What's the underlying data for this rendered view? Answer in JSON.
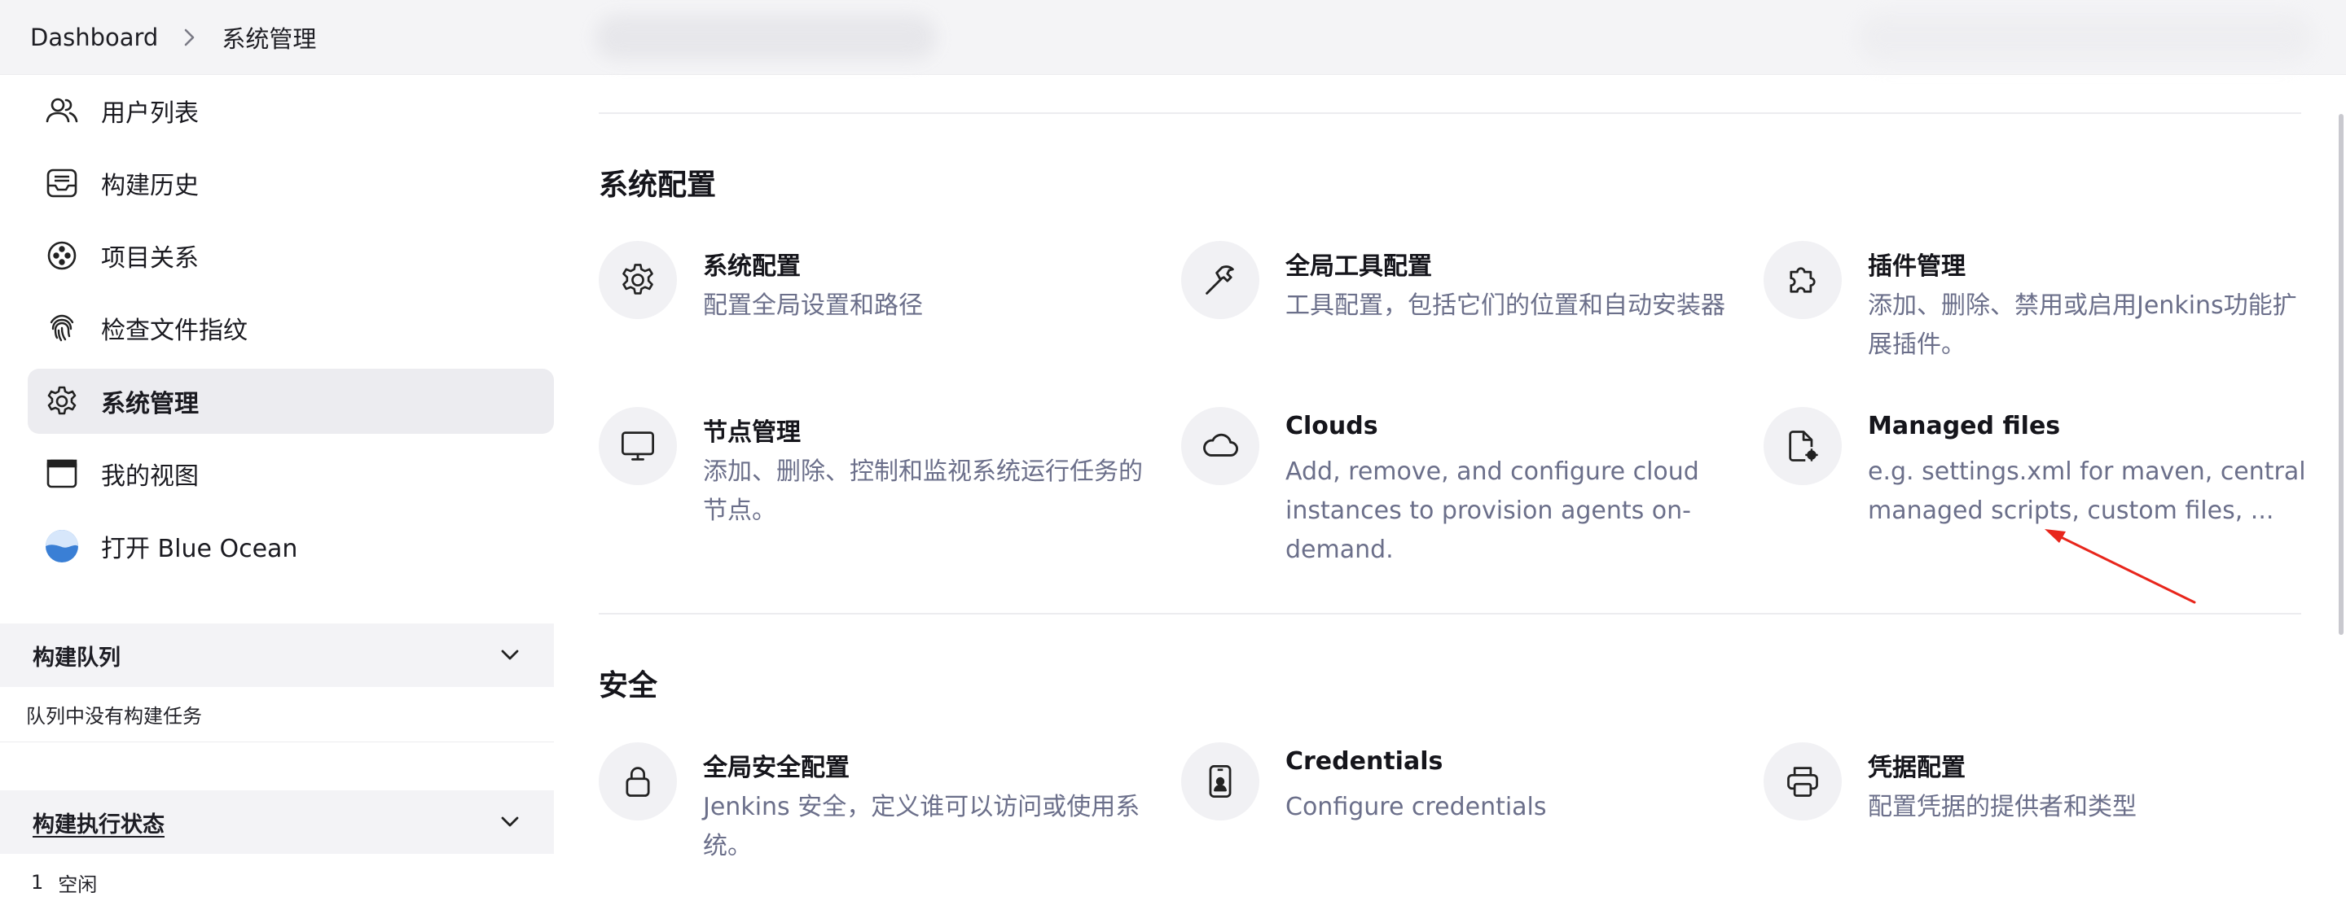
{
  "breadcrumb": {
    "home": "Dashboard",
    "current": "系统管理"
  },
  "sidebar": {
    "items": [
      {
        "label": "用户列表",
        "icon": "users-icon"
      },
      {
        "label": "构建历史",
        "icon": "inbox-icon"
      },
      {
        "label": "项目关系",
        "icon": "relationship-icon"
      },
      {
        "label": "检查文件指纹",
        "icon": "fingerprint-icon"
      },
      {
        "label": "系统管理",
        "icon": "gear-icon",
        "active": true
      },
      {
        "label": "我的视图",
        "icon": "window-icon"
      },
      {
        "label": "打开 Blue Ocean",
        "icon": "blue-ocean-icon"
      }
    ]
  },
  "build_queue": {
    "title": "构建队列",
    "empty_text": "队列中没有构建任务"
  },
  "executors": {
    "title": "构建执行状态",
    "row_index": "1",
    "row_status": "空闲"
  },
  "sections": [
    {
      "title": "系统配置",
      "cards": [
        {
          "title": "系统配置",
          "desc": "配置全局设置和路径",
          "icon": "gear-icon"
        },
        {
          "title": "全局工具配置",
          "desc": "工具配置，包括它们的位置和自动安装器",
          "icon": "hammer-icon"
        },
        {
          "title": "插件管理",
          "desc": "添加、删除、禁用或启用Jenkins功能扩展插件。",
          "icon": "puzzle-icon"
        },
        {
          "title": "节点管理",
          "desc": "添加、删除、控制和监视系统运行任务的节点。",
          "icon": "monitor-icon"
        },
        {
          "title": "Clouds",
          "desc": "Add, remove, and configure cloud instances to provision agents on-demand.",
          "icon": "cloud-icon"
        },
        {
          "title": "Managed files",
          "desc": "e.g. settings.xml for maven, central managed scripts, custom files, ...",
          "icon": "file-gear-icon"
        }
      ]
    },
    {
      "title": "安全",
      "cards": [
        {
          "title": "全局安全配置",
          "desc": "Jenkins 安全，定义谁可以访问或使用系统。",
          "icon": "lock-icon"
        },
        {
          "title": "Credentials",
          "desc": "Configure credentials",
          "icon": "id-badge-icon"
        },
        {
          "title": "凭据配置",
          "desc": "配置凭据的提供者和类型",
          "icon": "printer-icon"
        }
      ]
    }
  ],
  "annotation_color": "#e8261c"
}
